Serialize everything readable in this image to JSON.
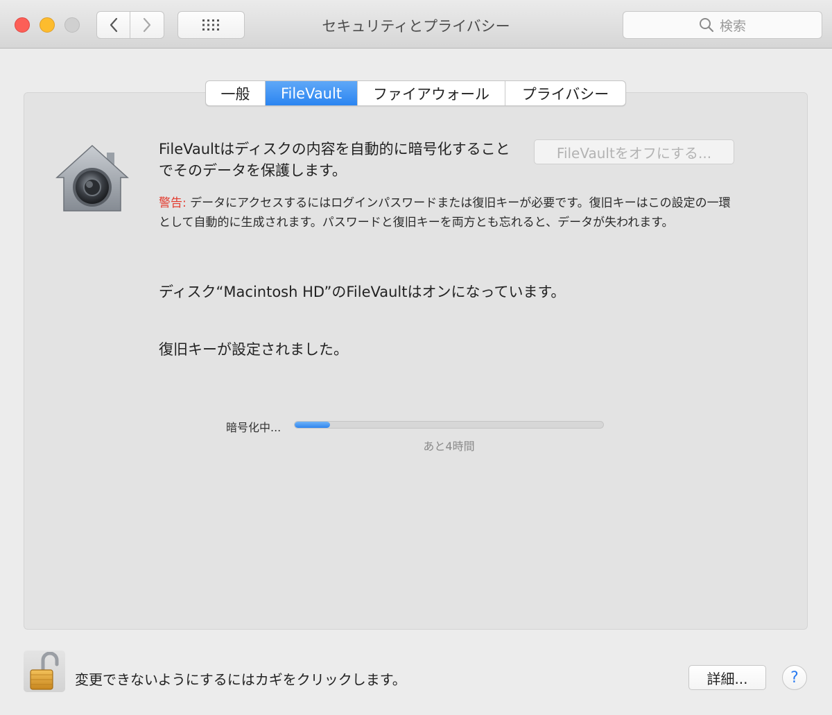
{
  "window": {
    "title": "セキュリティとプライバシー",
    "search_placeholder": "検索"
  },
  "toolbar": {
    "back_icon": "chevron-left-icon",
    "forward_icon": "chevron-right-icon",
    "grid_icon": "show-all-grid-icon"
  },
  "tabs": [
    {
      "label": "一般",
      "active": false
    },
    {
      "label": "FileVault",
      "active": true
    },
    {
      "label": "ファイアウォール",
      "active": false
    },
    {
      "label": "プライバシー",
      "active": false
    }
  ],
  "filevault": {
    "description": "FileVaultはディスクの内容を自動的に暗号化することでそのデータを保護します。",
    "turn_off_button": "FileVaultをオフにする...",
    "warning_label": "警告:",
    "warning_text": " データにアクセスするにはログインパスワードまたは復旧キーが必要です。復旧キーはこの設定の一環として自動的に生成されます。パスワードと復旧キーを両方とも忘れると、データが失われます。",
    "status": "ディスク“Macintosh HD”のFileVaultはオンになっています。",
    "recovery_status": "復旧キーが設定されました。",
    "progress_label": "暗号化中...",
    "progress_fraction": 0.115,
    "remaining": "あと4時間"
  },
  "footer": {
    "lock_text": "変更できないようにするにはカギをクリックします。",
    "details_button": "詳細...",
    "help_button": "?"
  },
  "colors": {
    "accent": "#2b85f1",
    "warning": "#e33b2e",
    "close": "#fc5f57",
    "minimize": "#fdbc2e"
  }
}
